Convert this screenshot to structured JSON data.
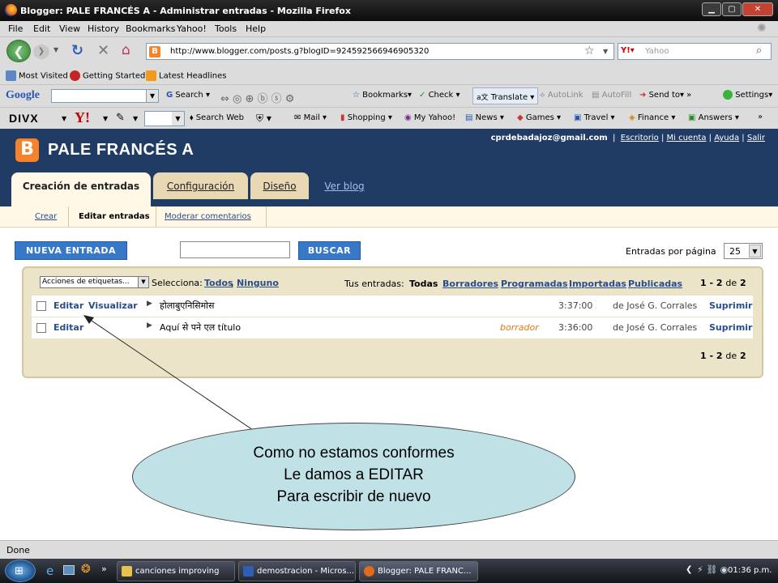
{
  "window": {
    "title": "Blogger: PALE FRANCÉS A - Administrar entradas - Mozilla Firefox"
  },
  "menu": [
    "File",
    "Edit",
    "View",
    "History",
    "Bookmarks",
    "Yahoo!",
    "Tools",
    "Help"
  ],
  "nav": {
    "url": "http://www.blogger.com/posts.g?blogID=924592566946905320",
    "search_placeholder": "Yahoo"
  },
  "bookmarks": [
    "Most Visited",
    "Getting Started",
    "Latest Headlines"
  ],
  "google_toolbar": {
    "brand": "Google",
    "items": [
      "Search",
      "Bookmarks",
      "Check",
      "Translate",
      "AutoLink",
      "AutoFill",
      "Send to",
      "Settings"
    ]
  },
  "divx_toolbar": {
    "brand": "DIVX",
    "yahoo": "Y!",
    "items": [
      "Search Web",
      "Mail",
      "Shopping",
      "My Yahoo!",
      "News",
      "Games",
      "Travel",
      "Finance",
      "Answers"
    ]
  },
  "blogger": {
    "logo": "B",
    "blog_title": "PALE FRANCÉS A",
    "user_email": "cprdebadajoz@gmail.com",
    "top_links": [
      "Escritorio",
      "Mi cuenta",
      "Ayuda",
      "Salir"
    ],
    "tabs": [
      "Creación de entradas",
      "Configuración",
      "Diseño",
      "Ver blog"
    ],
    "subtabs": [
      "Crear",
      "Editar entradas",
      "Moderar comentarios"
    ],
    "new_post_button": "NUEVA ENTRADA",
    "search_button": "BUSCAR",
    "per_page_label": "Entradas por página",
    "per_page_value": "25",
    "label_actions": "Acciones de etiquetas...",
    "select_label": "Selecciona:",
    "select_all": "Todos",
    "select_none": "Ninguno",
    "your_posts_label": "Tus entradas:",
    "filters": [
      "Todas",
      "Borradores",
      "Programadas",
      "Importadas",
      "Publicadas"
    ],
    "pagination": {
      "from": "1",
      "to": "2",
      "of": "de",
      "total": "2"
    },
    "posts": [
      {
        "edit": "Editar",
        "view": "Visualizar",
        "title": "होलाबुएनिसिमोस",
        "status": "",
        "time": "3:37:00",
        "author": "de José G. Corrales",
        "delete": "Suprimir"
      },
      {
        "edit": "Editar",
        "view": "",
        "title": "Aquí से पने एल título",
        "status": "borrador",
        "time": "3:36:00",
        "author": "de José G. Corrales",
        "delete": "Suprimir"
      }
    ]
  },
  "callout": {
    "lines": [
      "Como no estamos conformes",
      "Le damos a EDITAR",
      "Para escribir de nuevo"
    ]
  },
  "status_bar": {
    "text": "Done"
  },
  "taskbar": {
    "tasks": [
      "canciones improving",
      "demostracion - Micros...",
      "Blogger: PALE FRANC..."
    ],
    "clock": "01:36 p.m."
  },
  "colors": {
    "blogger_header": "#203c65",
    "link": "#2a4d8c",
    "button": "#3779c8",
    "draft": "#e07b14",
    "callout": "#c0e2e6"
  }
}
